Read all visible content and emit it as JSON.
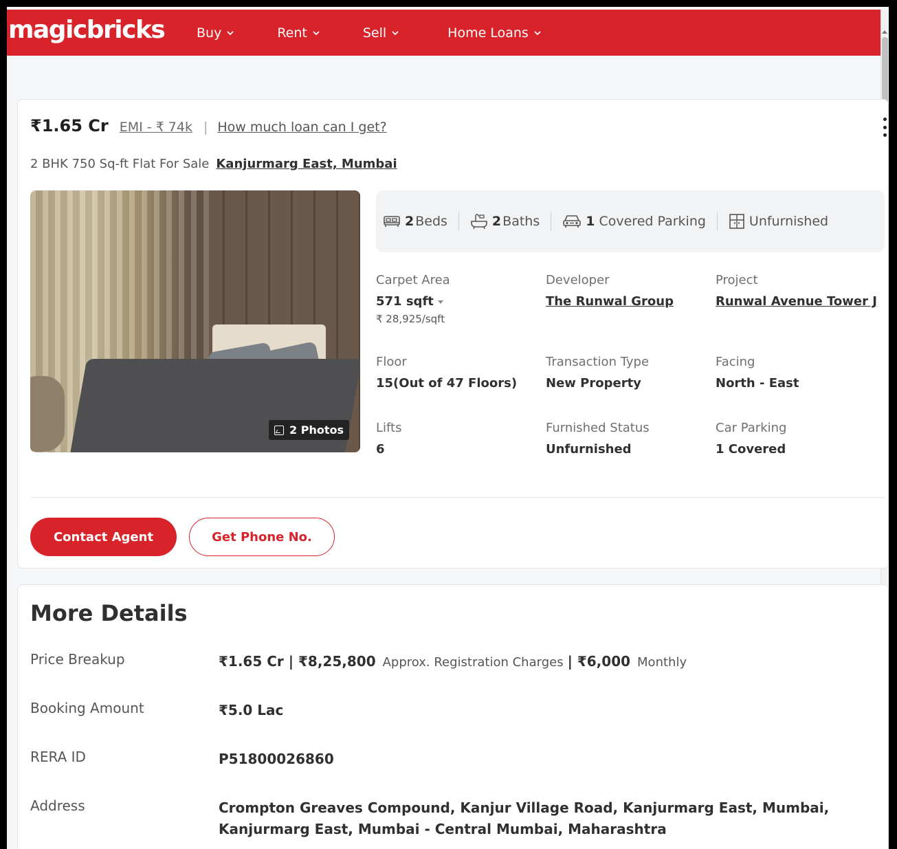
{
  "header": {
    "logo": "magicbricks",
    "nav": [
      {
        "label": "Buy"
      },
      {
        "label": "Rent"
      },
      {
        "label": "Sell"
      },
      {
        "label": "Home Loans"
      }
    ]
  },
  "listing": {
    "price": "₹1.65 Cr",
    "emi": "EMI - ₹ 74k",
    "separator": "|",
    "loan_link": "How much loan can I get?",
    "title": "2 BHK 750 Sq-ft Flat For Sale",
    "location": "Kanjurmarg East, Mumbai",
    "photos_badge": "2 Photos",
    "summary": {
      "beds_num": "2",
      "beds_label": "Beds",
      "baths_num": "2",
      "baths_label": "Baths",
      "parking_num": "1",
      "parking_label": "Covered Parking",
      "furnishing": "Unfurnished"
    },
    "details": {
      "carpet_area_label": "Carpet Area",
      "carpet_area_value": "571 sqft",
      "price_per_sqft": "₹ 28,925/sqft",
      "developer_label": "Developer",
      "developer_value": "The Runwal Group",
      "project_label": "Project",
      "project_value": "Runwal Avenue Tower J",
      "floor_label": "Floor",
      "floor_value": "15(Out of 47 Floors)",
      "transaction_label": "Transaction Type",
      "transaction_value": "New Property",
      "facing_label": "Facing",
      "facing_value": "North - East",
      "lifts_label": "Lifts",
      "lifts_value": "6",
      "furnished_label": "Furnished Status",
      "furnished_value": "Unfurnished",
      "car_parking_label": "Car Parking",
      "car_parking_value": "1 Covered"
    },
    "buttons": {
      "contact": "Contact Agent",
      "phone": "Get Phone No."
    }
  },
  "more_details": {
    "title": "More Details",
    "price_breakup_label": "Price Breakup",
    "price_breakup_price": "₹1.65 Cr | ₹8,25,800",
    "price_breakup_reg": "Approx. Registration Charges",
    "price_breakup_monthly_amt": "| ₹6,000",
    "price_breakup_monthly": "Monthly",
    "booking_label": "Booking Amount",
    "booking_value": "₹5.0 Lac",
    "rera_label": "RERA ID",
    "rera_value": "P51800026860",
    "address_label": "Address",
    "address_value": "Crompton Greaves Compound, Kanjur Village Road, Kanjurmarg East, Mumbai, Kanjurmarg East, Mumbai - Central Mumbai, Maharashtra"
  }
}
